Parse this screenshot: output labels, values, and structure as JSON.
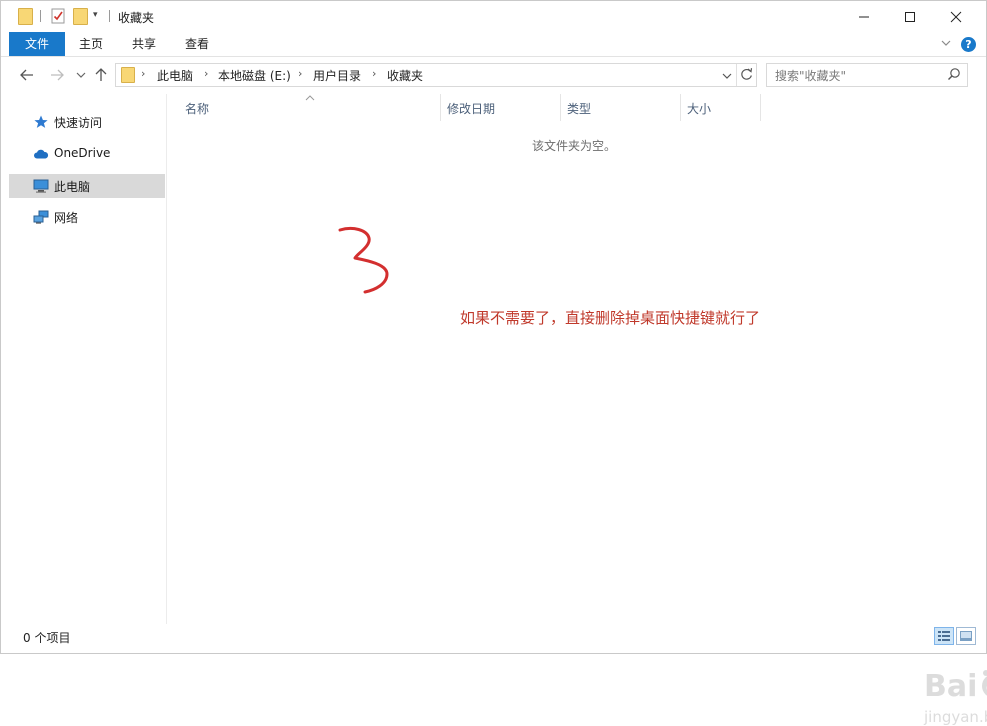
{
  "window": {
    "title": "收藏夹",
    "controls": {
      "minimize": "—",
      "maximize": "☐",
      "close": "✕"
    }
  },
  "ribbon": {
    "tabs": [
      {
        "label": "文件",
        "active": true
      },
      {
        "label": "主页"
      },
      {
        "label": "共享"
      },
      {
        "label": "查看"
      }
    ]
  },
  "nav": {
    "breadcrumbs": [
      "此电脑",
      "本地磁盘 (E:)",
      "用户目录",
      "收藏夹"
    ],
    "search": {
      "placeholder": "搜索\"收藏夹\""
    }
  },
  "sidebar": {
    "items": [
      {
        "label": "快速访问",
        "icon": "star-icon"
      },
      {
        "label": "OneDrive",
        "icon": "cloud-icon"
      },
      {
        "label": "此电脑",
        "icon": "computer-icon",
        "selected": true
      },
      {
        "label": "网络",
        "icon": "network-icon"
      }
    ]
  },
  "content": {
    "columns": [
      "名称",
      "修改日期",
      "类型",
      "大小"
    ],
    "empty_message": "该文件夹为空。",
    "annotation_mark": "3",
    "annotation_text": "如果不需要了，直接删除掉桌面快捷键就行了"
  },
  "statusbar": {
    "item_count": "0 个项目"
  },
  "watermark": {
    "brand": "Baidu经验",
    "url": "jingyan.baidu.com"
  },
  "colors": {
    "file_tab": "#1979ca",
    "annotation": "#c0392b",
    "selected_nav": "#d9d9d9",
    "column_header_text": "#4c607a"
  }
}
